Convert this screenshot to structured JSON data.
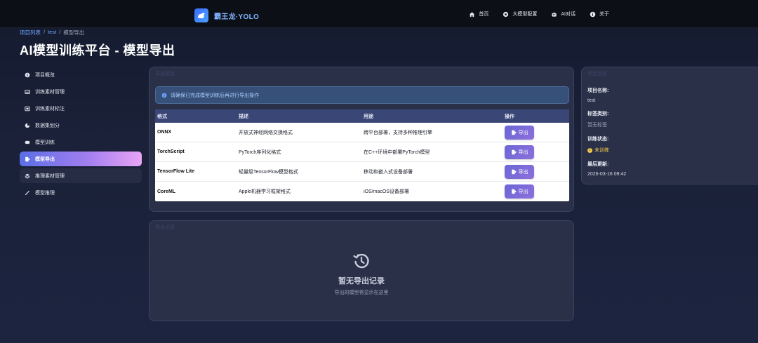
{
  "brand": {
    "name": "霸王龙·YOLO"
  },
  "nav": [
    {
      "label": "首页",
      "icon": "home-icon"
    },
    {
      "label": "大模型配置",
      "icon": "model-config-icon"
    },
    {
      "label": "AI对话",
      "icon": "robot-icon"
    },
    {
      "label": "关于",
      "icon": "info-icon"
    }
  ],
  "breadcrumb": {
    "items": [
      "项目列表",
      "test",
      "模型导出"
    ],
    "separator": "/"
  },
  "page": {
    "title": "AI模型训练平台 - 模型导出"
  },
  "sidebar": {
    "items": [
      {
        "label": "项目概览",
        "icon": "info-circle-icon"
      },
      {
        "label": "训练素材管理",
        "icon": "images-icon"
      },
      {
        "label": "训练素材标注",
        "icon": "annotate-icon"
      },
      {
        "label": "数据集划分",
        "icon": "pie-chart-icon"
      },
      {
        "label": "模型训练",
        "icon": "brain-icon"
      },
      {
        "label": "模型导出",
        "icon": "export-icon"
      },
      {
        "label": "推理素材管理",
        "icon": "layers-icon"
      },
      {
        "label": "模型推理",
        "icon": "magic-wand-icon"
      }
    ],
    "active_index": 5
  },
  "export_card": {
    "header": "导出模型",
    "alert": "请确保已完成模型训练后再进行导出操作",
    "columns": [
      "格式",
      "描述",
      "用途",
      "操作"
    ],
    "rows": [
      {
        "format": "ONNX",
        "desc": "开放式神经网络交换格式",
        "usage": "跨平台部署，支持多种推理引擎",
        "action": "导出"
      },
      {
        "format": "TorchScript",
        "desc": "PyTorch序列化格式",
        "usage": "在C++环境中部署PyTorch模型",
        "action": "导出"
      },
      {
        "format": "TensorFlow Lite",
        "desc": "轻量级TensorFlow模型格式",
        "usage": "移动和嵌入式设备部署",
        "action": "导出"
      },
      {
        "format": "CoreML",
        "desc": "Apple机器学习框架格式",
        "usage": "iOS/macOS设备部署",
        "action": "导出"
      }
    ]
  },
  "history_card": {
    "header": "导出记录",
    "empty_title": "暂无导出记录",
    "empty_subtitle": "导出的模型将显示在这里"
  },
  "info_card": {
    "header": "项目信息",
    "fields": {
      "name_label": "项目名称:",
      "name_value": "test",
      "labels_label": "标签类别:",
      "labels_value": "暂无标签",
      "status_label": "训练状态:",
      "status_value": "未训练",
      "updated_label": "最后更新:",
      "updated_value": "2026-03-16 09:42"
    }
  },
  "colors": {
    "accent": "#6a67d6",
    "active_gradient_end": "#e9a4f5",
    "status_warn": "#f2c94c",
    "link": "#6ea4ff"
  }
}
